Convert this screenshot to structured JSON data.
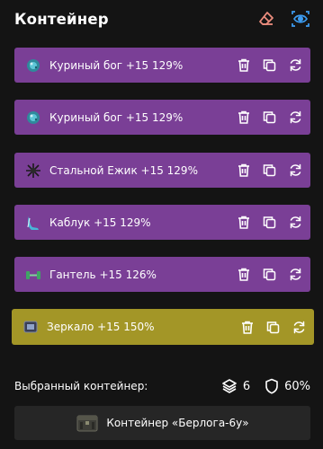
{
  "header": {
    "title": "Контейнер",
    "eraser_icon": "eraser-icon",
    "eye_icon": "eye-icon",
    "eraser_color": "#ec8d7e",
    "eye_color": "#3d9df2"
  },
  "items": [
    {
      "label": "Куриный бог +15 129%",
      "icon": "chicken-god-icon"
    },
    {
      "label": "Куриный бог +15 129%",
      "icon": "chicken-god-icon"
    },
    {
      "label": "Стальной Ежик +15 129%",
      "icon": "steel-hedgehog-icon"
    },
    {
      "label": "Каблук +15 129%",
      "icon": "heel-icon"
    },
    {
      "label": "Гантель +15 126%",
      "icon": "dumbbell-icon"
    },
    {
      "label": "Зеркало +15 150%",
      "icon": "mirror-icon",
      "selected": true
    }
  ],
  "colors": {
    "item_bg": "#7a3f96",
    "selected_bg": "#a39627",
    "page_bg": "#141414"
  },
  "selected": {
    "label": "Выбранный контейнер:",
    "layers_count": "6",
    "defense_percent": "60%"
  },
  "container": {
    "name": "Контейнер «Берлога-6у»"
  }
}
